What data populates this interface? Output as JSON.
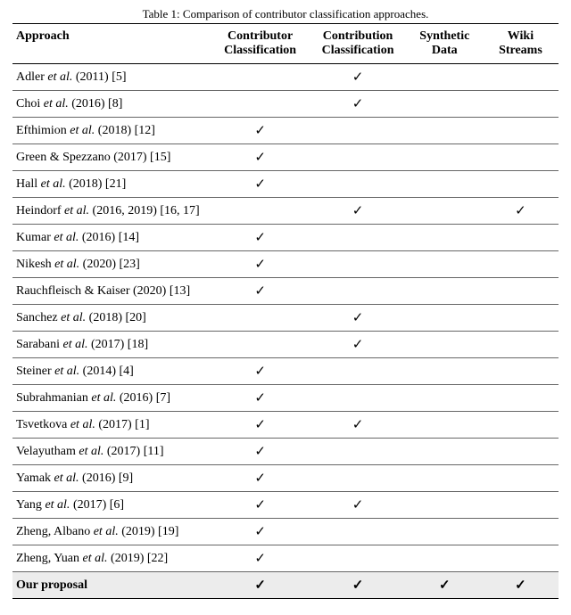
{
  "caption": "Table 1: Comparison of contributor classification approaches.",
  "headers": {
    "approach": "Approach",
    "col2_l1": "Contributor",
    "col2_l2": "Classification",
    "col3_l1": "Contribution",
    "col3_l2": "Classification",
    "col4_l1": "Synthetic",
    "col4_l2": "Data",
    "col5_l1": "Wiki",
    "col5_l2": "Streams"
  },
  "chart_data": {
    "type": "table",
    "columns": [
      "Approach",
      "Contributor Classification",
      "Contribution Classification",
      "Synthetic Data",
      "Wiki Streams"
    ],
    "rows": [
      {
        "approach_pre": "Adler ",
        "approach_ital": "et al.",
        "approach_post": " (2011) [5]",
        "c2": false,
        "c3": true,
        "c4": false,
        "c5": false,
        "highlight": false
      },
      {
        "approach_pre": "Choi ",
        "approach_ital": "et al.",
        "approach_post": " (2016) [8]",
        "c2": false,
        "c3": true,
        "c4": false,
        "c5": false,
        "highlight": false
      },
      {
        "approach_pre": "Efthimion ",
        "approach_ital": "et al.",
        "approach_post": " (2018) [12]",
        "c2": true,
        "c3": false,
        "c4": false,
        "c5": false,
        "highlight": false
      },
      {
        "approach_pre": "Green & Spezzano (2017) [15]",
        "approach_ital": "",
        "approach_post": "",
        "c2": true,
        "c3": false,
        "c4": false,
        "c5": false,
        "highlight": false
      },
      {
        "approach_pre": "Hall ",
        "approach_ital": "et al.",
        "approach_post": " (2018) [21]",
        "c2": true,
        "c3": false,
        "c4": false,
        "c5": false,
        "highlight": false
      },
      {
        "approach_pre": "Heindorf ",
        "approach_ital": "et al.",
        "approach_post": " (2016, 2019) [16, 17]",
        "c2": false,
        "c3": true,
        "c4": false,
        "c5": true,
        "highlight": false
      },
      {
        "approach_pre": "Kumar ",
        "approach_ital": "et al.",
        "approach_post": " (2016) [14]",
        "c2": true,
        "c3": false,
        "c4": false,
        "c5": false,
        "highlight": false
      },
      {
        "approach_pre": "Nikesh ",
        "approach_ital": "et al.",
        "approach_post": " (2020) [23]",
        "c2": true,
        "c3": false,
        "c4": false,
        "c5": false,
        "highlight": false
      },
      {
        "approach_pre": "Rauchfleisch & Kaiser (2020) [13]",
        "approach_ital": "",
        "approach_post": "",
        "c2": true,
        "c3": false,
        "c4": false,
        "c5": false,
        "highlight": false
      },
      {
        "approach_pre": "Sanchez ",
        "approach_ital": "et al.",
        "approach_post": " (2018) [20]",
        "c2": false,
        "c3": true,
        "c4": false,
        "c5": false,
        "highlight": false
      },
      {
        "approach_pre": "Sarabani ",
        "approach_ital": "et al.",
        "approach_post": " (2017) [18]",
        "c2": false,
        "c3": true,
        "c4": false,
        "c5": false,
        "highlight": false
      },
      {
        "approach_pre": "Steiner ",
        "approach_ital": "et al.",
        "approach_post": " (2014) [4]",
        "c2": true,
        "c3": false,
        "c4": false,
        "c5": false,
        "highlight": false
      },
      {
        "approach_pre": "Subrahmanian ",
        "approach_ital": "et al.",
        "approach_post": " (2016) [7]",
        "c2": true,
        "c3": false,
        "c4": false,
        "c5": false,
        "highlight": false
      },
      {
        "approach_pre": "Tsvetkova ",
        "approach_ital": "et al.",
        "approach_post": " (2017) [1]",
        "c2": true,
        "c3": true,
        "c4": false,
        "c5": false,
        "highlight": false
      },
      {
        "approach_pre": "Velayutham ",
        "approach_ital": "et al.",
        "approach_post": " (2017) [11]",
        "c2": true,
        "c3": false,
        "c4": false,
        "c5": false,
        "highlight": false
      },
      {
        "approach_pre": "Yamak ",
        "approach_ital": "et al.",
        "approach_post": " (2016) [9]",
        "c2": true,
        "c3": false,
        "c4": false,
        "c5": false,
        "highlight": false
      },
      {
        "approach_pre": "Yang ",
        "approach_ital": "et al.",
        "approach_post": " (2017) [6]",
        "c2": true,
        "c3": true,
        "c4": false,
        "c5": false,
        "highlight": false
      },
      {
        "approach_pre": "Zheng, Albano ",
        "approach_ital": "et al.",
        "approach_post": " (2019) [19]",
        "c2": true,
        "c3": false,
        "c4": false,
        "c5": false,
        "highlight": false
      },
      {
        "approach_pre": "Zheng, Yuan ",
        "approach_ital": "et al.",
        "approach_post": " (2019) [22]",
        "c2": true,
        "c3": false,
        "c4": false,
        "c5": false,
        "highlight": false
      },
      {
        "approach_pre": "Our proposal",
        "approach_ital": "",
        "approach_post": "",
        "c2": true,
        "c3": true,
        "c4": true,
        "c5": true,
        "highlight": true
      }
    ]
  }
}
